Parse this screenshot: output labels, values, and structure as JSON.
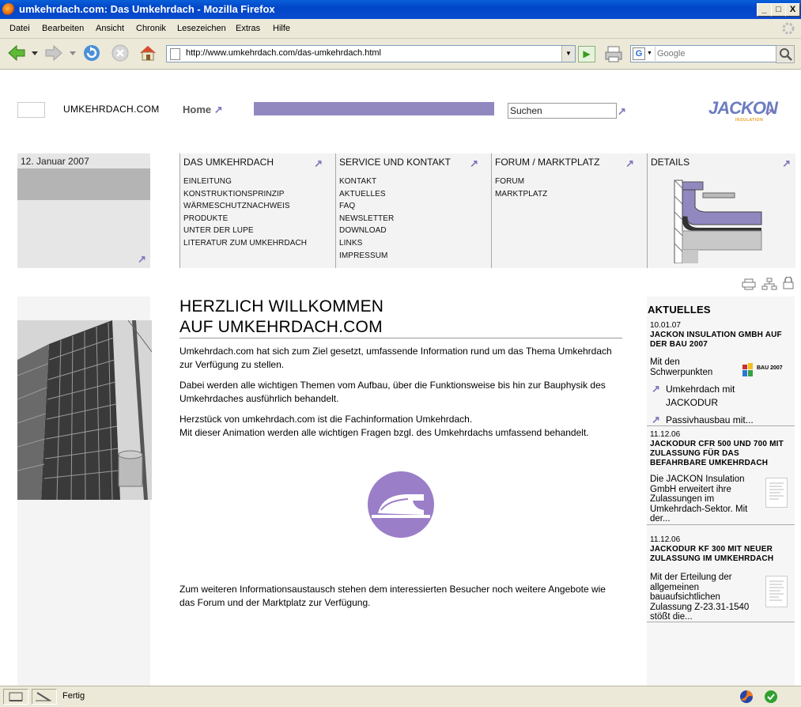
{
  "window": {
    "title": "umkehrdach.com: Das Umkehrdach - Mozilla Firefox",
    "controls": [
      "_",
      "□",
      "X"
    ]
  },
  "menu": [
    "Datei",
    "Bearbeiten",
    "Ansicht",
    "Chronik",
    "Lesezeichen",
    "Extras",
    "Hilfe"
  ],
  "toolbar": {
    "url": "http://www.umkehrdach.com/das-umkehrdach.html",
    "search_placeholder": "Google",
    "search_engine_letter": "G"
  },
  "status": {
    "text": "Fertig"
  },
  "site": {
    "name": "UMKEHRDACH.COM",
    "home": "Home",
    "search_value": "Suchen",
    "logo": "JACKON",
    "logo_sub": "INSULATION",
    "date": "12. Januar 2007",
    "nav": [
      {
        "title": "DAS UMKEHRDACH",
        "items": [
          "EINLEITUNG",
          "KONSTRUKTIONSPRINZIP",
          "WÄRMESCHUTZNACHWEIS",
          "PRODUKTE",
          "UNTER DER LUPE",
          "LITERATUR ZUM UMKEHRDACH"
        ]
      },
      {
        "title": "SERVICE UND KONTAKT",
        "items": [
          "KONTAKT",
          "AKTUELLES",
          "FAQ",
          "NEWSLETTER",
          "DOWNLOAD",
          "LINKS",
          "IMPRESSUM"
        ]
      },
      {
        "title": "FORUM / MARKTPLATZ",
        "items": [
          "FORUM",
          "MARKTPLATZ"
        ]
      },
      {
        "title": "DETAILS",
        "items": []
      }
    ]
  },
  "main": {
    "heading_line1": "HERZLICH WILLKOMMEN",
    "heading_line2": "AUF UMKEHRDACH.COM",
    "p1": "Umkehrdach.com hat sich zum Ziel gesetzt, umfassende Information rund um das Thema Umkehrdach zur Verfügung zu stellen.",
    "p2": "Dabei werden alle wichtigen Themen vom Aufbau, über die Funktionsweise bis hin zur Bauphysik des Umkehrdaches ausführlich behandelt.",
    "p3a": "Herzstück von umkehrdach.com ist die Fachinformation Umkehrdach.",
    "p3b": "Mit dieser Animation werden alle wichtigen Fragen bzgl. des Umkehrdachs umfassend behandelt.",
    "p4": "Zum weiteren Informationsaustausch stehen dem interessierten Besucher noch weitere Angebote wie das Forum und der Marktplatz zur Verfügung."
  },
  "aktuelles": {
    "heading": "AKTUELLES",
    "news": [
      {
        "date": "10.01.07",
        "title": "JACKON INSULATION GMBH AUF DER BAU 2007",
        "body": "Mit den Schwerpunkten",
        "links": [
          "Umkehrdach mit JACKODUR",
          "Passivhausbau mit..."
        ],
        "thumb_label": "BAU 2007"
      },
      {
        "date": "11.12.06",
        "title": "JACKODUR CFR 500 UND 700 MIT ZULASSUNG FÜR DAS BEFAHRBARE UMKEHRDACH",
        "body": "Die JACKON Insulation GmbH erweitert ihre Zulassungen im Umkehrdach-Sektor. Mit der..."
      },
      {
        "date": "11.12.06",
        "title": "JACKODUR KF 300 MIT NEUER ZULASSUNG IM UMKEHRDACH",
        "body": "Mit der Erteilung der allgemeinen bauaufsichtlichen Zulassung Z-23.31-1540 stößt die..."
      }
    ]
  },
  "colors": {
    "accent": "#9188c0",
    "arrow": "#8272b8"
  }
}
